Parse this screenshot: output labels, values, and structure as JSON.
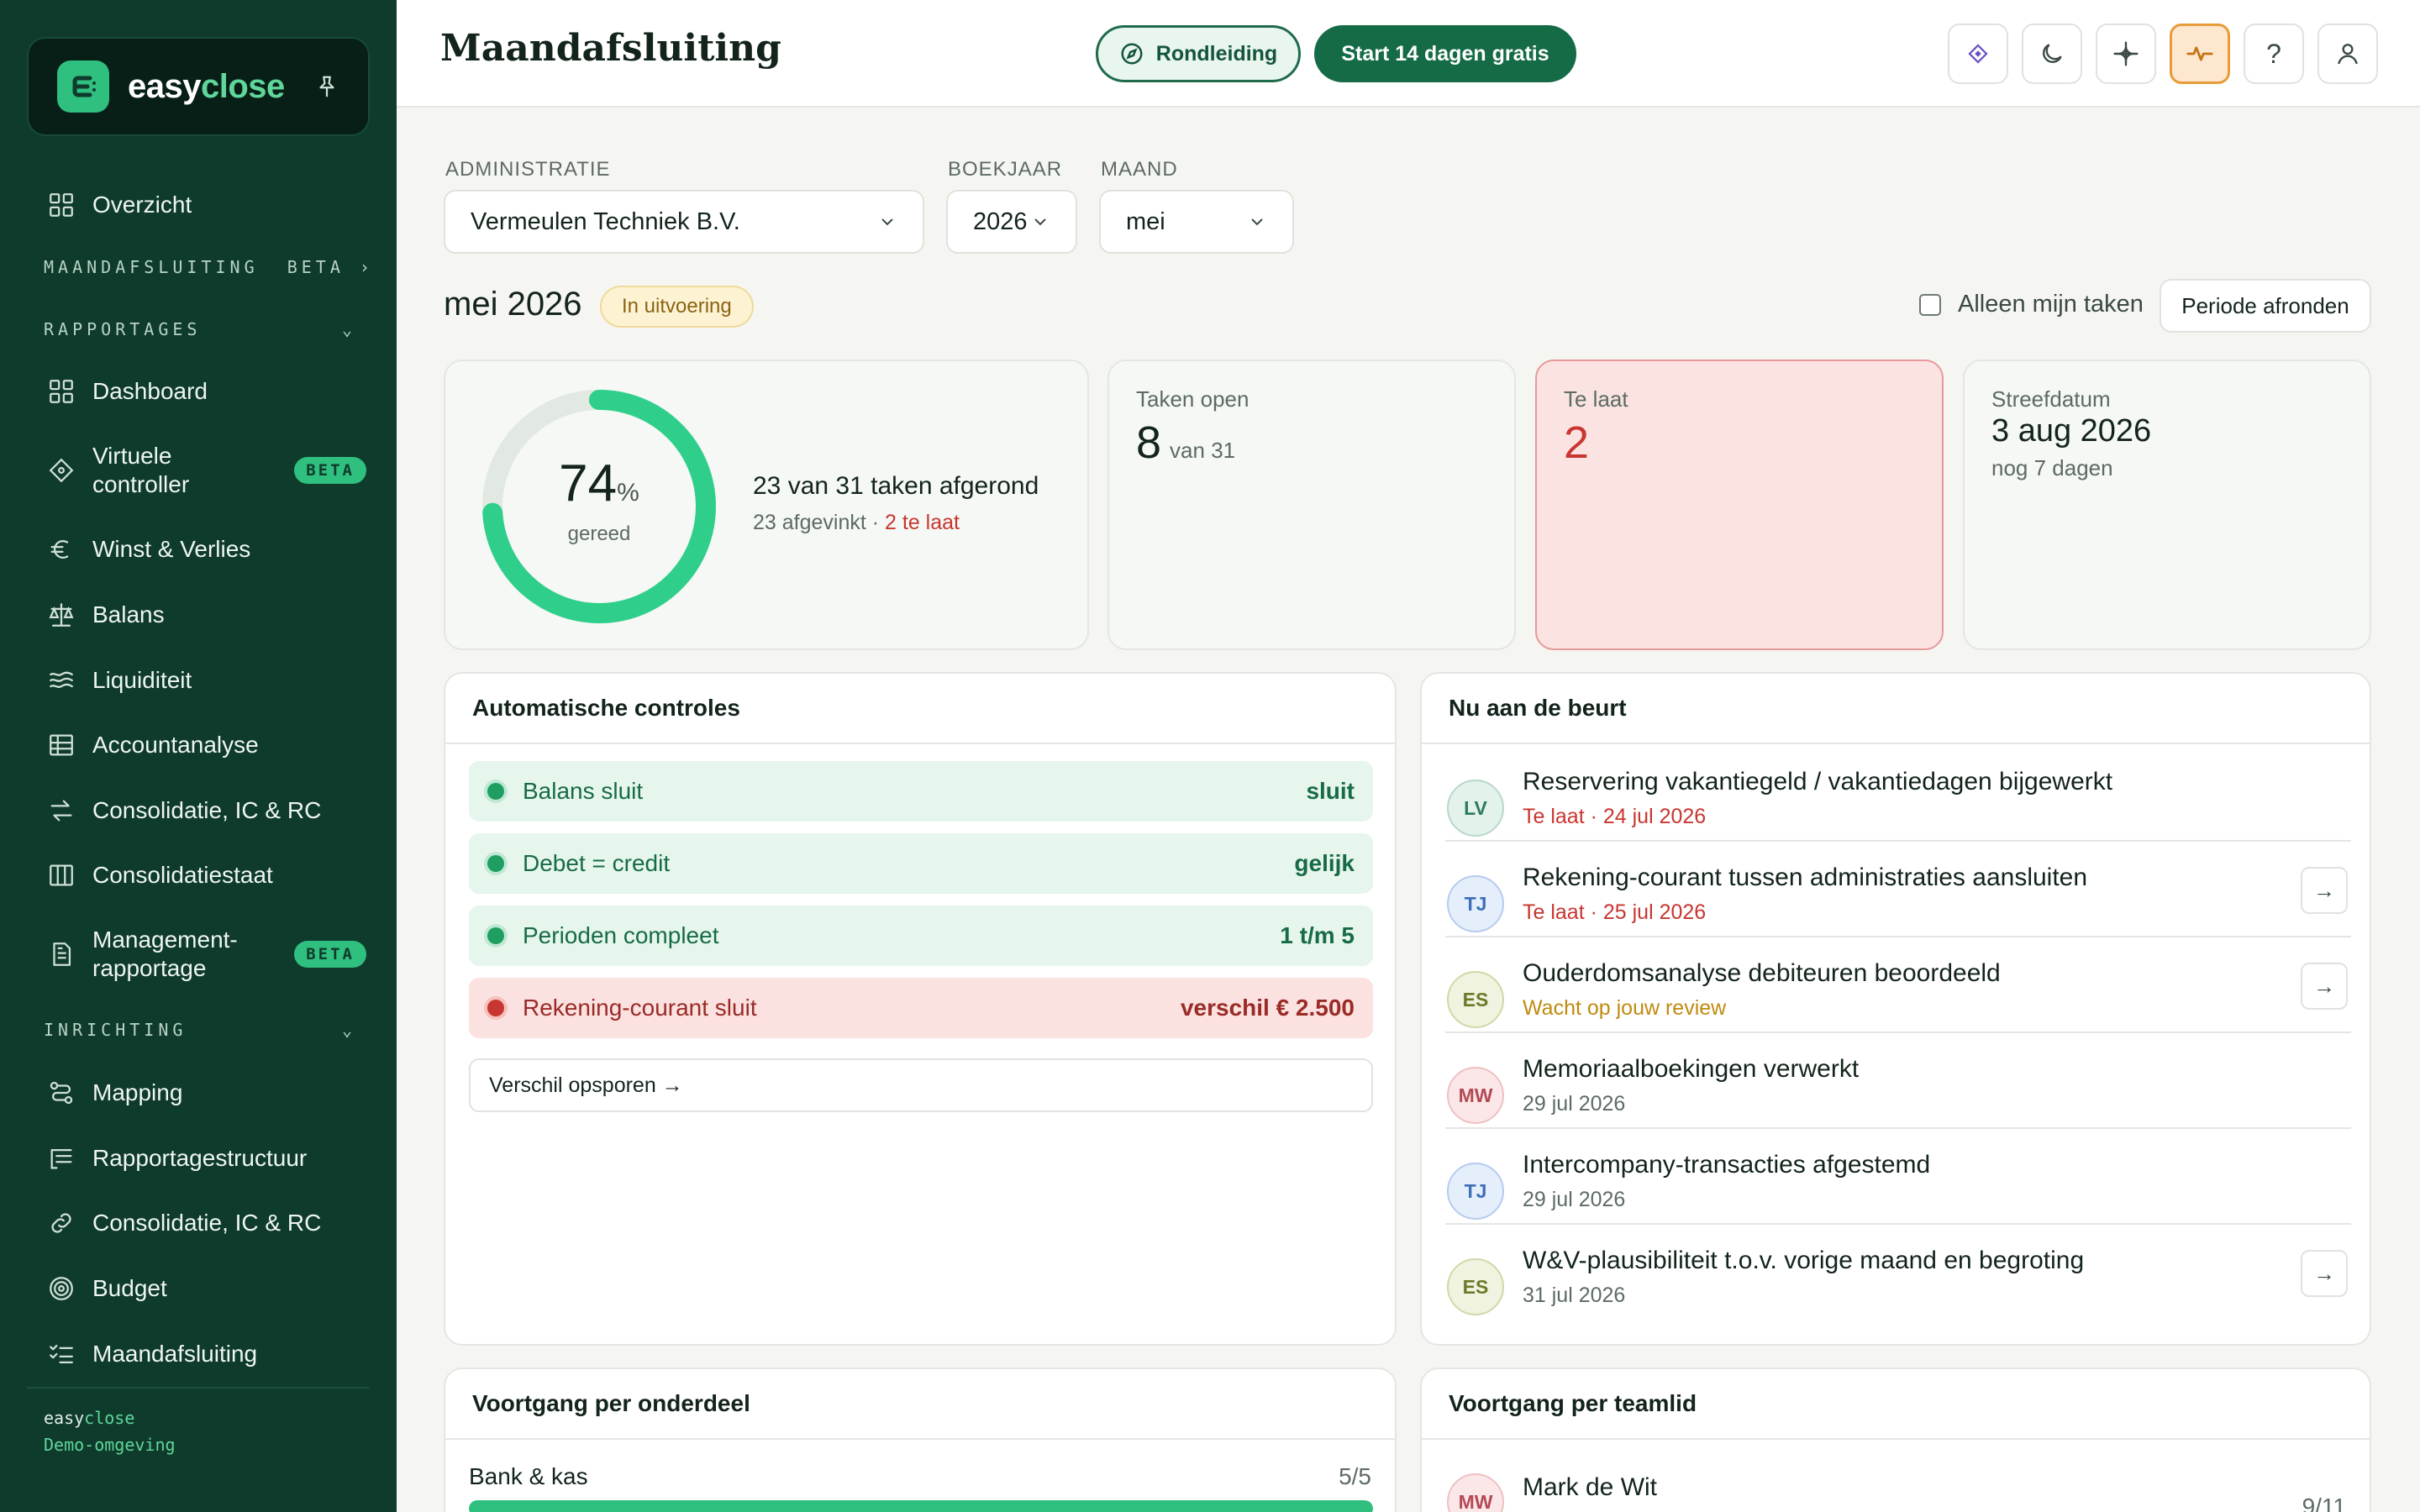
{
  "brand": {
    "part1": "easy",
    "part2": "close"
  },
  "sidebar": {
    "items": [
      {
        "label": "Overzicht",
        "icon": "grid-icon"
      },
      {
        "label": "Dashboard",
        "icon": "grid-icon"
      },
      {
        "label": "Virtuele\ncontroller",
        "icon": "diamond-icon",
        "badge": "BETA"
      },
      {
        "label": "Winst & Verlies",
        "icon": "euro-icon"
      },
      {
        "label": "Balans",
        "icon": "scale-icon"
      },
      {
        "label": "Liquiditeit",
        "icon": "waves-icon"
      },
      {
        "label": "Accountanalyse",
        "icon": "table-icon"
      },
      {
        "label": "Consolidatie, IC & RC",
        "icon": "arrows-icon"
      },
      {
        "label": "Consolidatiestaat",
        "icon": "columns-icon"
      },
      {
        "label": "Management-\nrapportage",
        "icon": "document-icon",
        "badge": "BETA"
      },
      {
        "label": "Mapping",
        "icon": "route-icon"
      },
      {
        "label": "Rapportagestructuur",
        "icon": "list-tree-icon"
      },
      {
        "label": "Consolidatie, IC & RC",
        "icon": "link-icon"
      },
      {
        "label": "Budget",
        "icon": "target-icon"
      },
      {
        "label": "Maandafsluiting",
        "icon": "checklist-icon"
      }
    ],
    "sections": {
      "maandafsluiting": "MAANDAFSLUITING  BETA",
      "rapportages": "RAPPORTAGES",
      "inrichting": "INRICHTING"
    },
    "footer": {
      "line1a": "easy",
      "line1b": "close",
      "line2": "Demo-omgeving"
    }
  },
  "header": {
    "title": "Maandafsluiting",
    "tour_label": "Rondleiding",
    "trial_label": "Start 14 dagen gratis",
    "icons": [
      "ai-diamond-icon",
      "moon-icon",
      "sparkle-icon",
      "pulse-icon",
      "help-icon",
      "user-icon"
    ],
    "help_glyph": "?"
  },
  "filters": {
    "administratie_label": "ADMINISTRATIE",
    "administratie_value": "Vermeulen Techniek B.V.",
    "boekjaar_label": "BOEKJAAR",
    "boekjaar_value": "2026",
    "maand_label": "MAAND",
    "maand_value": "mei"
  },
  "period": {
    "title": "mei 2026",
    "status": "In uitvoering",
    "mine_label": "Alleen mijn taken",
    "close_label": "Periode afronden"
  },
  "progress": {
    "percent": 74,
    "percent_text": "74",
    "percent_sign": "%",
    "caption": "gereed",
    "title": "23 van 31 taken afgerond",
    "sub_checked": "23 afgevinkt · ",
    "sub_late": "2 te laat"
  },
  "stats": {
    "open_label": "Taken open",
    "open_value": "8",
    "open_sub": "van 31",
    "late_label": "Te laat",
    "late_value": "2",
    "due_label": "Streefdatum",
    "due_value": "3 aug 2026",
    "due_sub": "nog 7 dagen"
  },
  "controls": {
    "title": "Automatische controles",
    "rows": [
      {
        "label": "Balans sluit",
        "value": "sluit",
        "state": "ok"
      },
      {
        "label": "Debet = credit",
        "value": "gelijk",
        "state": "ok"
      },
      {
        "label": "Perioden compleet",
        "value": "1 t/m 5",
        "state": "ok"
      },
      {
        "label": "Rekening-courant sluit",
        "value": "verschil € 2.500",
        "state": "bad"
      }
    ],
    "trace_label": "Verschil opsporen →"
  },
  "turn": {
    "title": "Nu aan de beurt",
    "rows": [
      {
        "initials": "LV",
        "title": "Reservering vakantiegeld / vakantiedagen bijgewerkt",
        "sub": "Te laat · 24 jul 2026"
      },
      {
        "initials": "TJ",
        "title": "Rekening-courant tussen administraties aansluiten",
        "sub": "Te laat · 25 jul 2026",
        "arrow": "→"
      },
      {
        "initials": "ES",
        "title": "Ouderdomsanalyse debiteuren beoordeeld",
        "sub": "Wacht op jouw review",
        "arrow": "→"
      },
      {
        "initials": "MW",
        "title": "Memoriaalboekingen verwerkt",
        "sub": "29 jul 2026"
      },
      {
        "initials": "TJ",
        "title": "Intercompany-transacties afgestemd",
        "sub": "29 jul 2026"
      },
      {
        "initials": "ES",
        "title": "W&V-plausibiliteit t.o.v. vorige maand en begroting",
        "sub": "31 jul 2026",
        "arrow": "→"
      }
    ]
  },
  "sections_progress": {
    "title": "Voortgang per onderdeel",
    "rows": [
      {
        "label": "Bank & kas",
        "value": "5/5",
        "fraction": 1.0
      }
    ]
  },
  "team_progress": {
    "title": "Voortgang per teamlid",
    "rows": [
      {
        "initials": "MW",
        "name": "Mark de Wit",
        "value": "9/11"
      }
    ]
  },
  "colors": {
    "sidebar_bg": "#0f3b2c",
    "accent": "#2fbf7f",
    "primary_button": "#146b45",
    "late_red": "#c8362f",
    "warning": "#c08a10"
  }
}
